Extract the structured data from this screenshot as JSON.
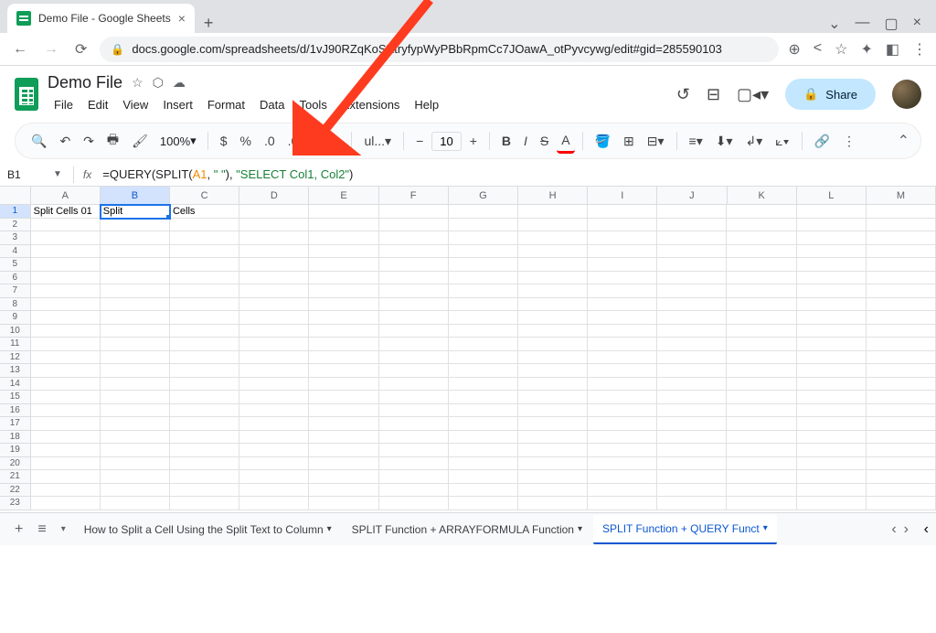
{
  "browser": {
    "tab_title": "Demo File - Google Sheets",
    "url": "docs.google.com/spreadsheets/d/1vJ90RZqKoSXtryfypWyPBbRpmCc7JOawA_otPyvcywg/edit#gid=285590103"
  },
  "doc": {
    "title": "Demo File",
    "menus": [
      "File",
      "Edit",
      "View",
      "Insert",
      "Format",
      "Data",
      "Tools",
      "Extensions",
      "Help"
    ]
  },
  "toolbar": {
    "zoom": "100%",
    "font_label": "ul...",
    "font_size": "10"
  },
  "share_label": "Share",
  "formula_bar": {
    "cell_ref": "B1",
    "prefix": "=QUERY(SPLIT(",
    "ref": "A1",
    "mid": ", ",
    "str1": "\" \"",
    "mid2": "), ",
    "str2": "\"SELECT Col1, Col2\"",
    "suffix": ")"
  },
  "columns": [
    "A",
    "B",
    "C",
    "D",
    "E",
    "F",
    "G",
    "H",
    "I",
    "J",
    "K",
    "L",
    "M"
  ],
  "cells": {
    "A1": "Split Cells 01",
    "B1": "Split",
    "C1": "Cells"
  },
  "selected_col": "B",
  "selected_row": 1,
  "row_count": 23,
  "sheet_tabs": {
    "items": [
      {
        "label": "How to Split a Cell Using the Split Text to Column",
        "active": false
      },
      {
        "label": "SPLIT Function + ARRAYFORMULA Function",
        "active": false
      },
      {
        "label": "SPLIT Function + QUERY Funct",
        "active": true
      }
    ]
  }
}
